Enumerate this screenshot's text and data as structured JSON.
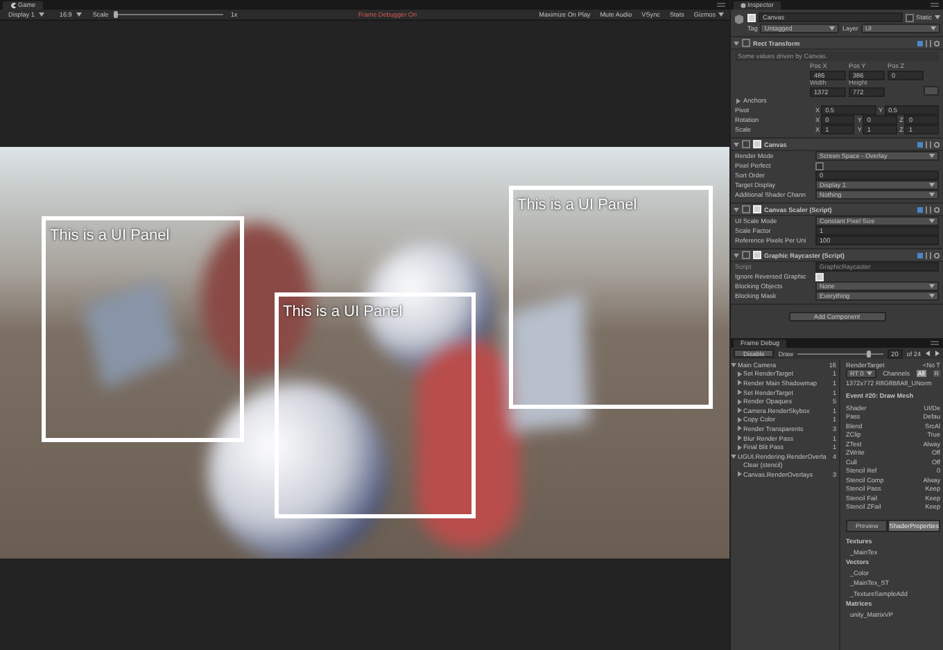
{
  "game": {
    "tab": "Game",
    "toolbar": {
      "display": "Display 1",
      "aspect": "16:9",
      "scale_label": "Scale",
      "scale_slider": {
        "level": 0
      },
      "scale_value": "1x",
      "frame_debugger": "Frame Debugger On",
      "toggles": [
        "Maximize On Play",
        "Mute Audio",
        "VSync",
        "Stats",
        "Gizmos"
      ]
    },
    "panels": [
      {
        "label": "This is a UI Panel"
      },
      {
        "label": "This is a UI Panel"
      },
      {
        "label": "This is a UI Panel"
      }
    ]
  },
  "inspector": {
    "tab": "Inspector",
    "object": {
      "name": "Canvas",
      "active": true,
      "static": "Static",
      "static_checked": false,
      "tag_label": "Tag",
      "tag": "Untagged",
      "layer_label": "Layer",
      "layer": "UI"
    },
    "components": [
      {
        "title": "Rect Transform",
        "note": "Some values driven by Canvas.",
        "rows": [
          {
            "kind": "stack",
            "cells": [
              {
                "label": "Pos X",
                "value": "486"
              },
              {
                "label": "Pos Y",
                "value": "386"
              },
              {
                "label": "Pos Z",
                "value": "0"
              }
            ]
          },
          {
            "kind": "stack",
            "cells": [
              {
                "label": "Width",
                "value": "1372"
              },
              {
                "label": "Height",
                "value": "772"
              }
            ]
          },
          {
            "kind": "heading",
            "label": "Anchors",
            "expanded": false
          },
          {
            "kind": "vec",
            "label": "Pivot",
            "cells": [
              {
                "axis": "X",
                "value": "0.5"
              },
              {
                "axis": "Y",
                "value": "0.5"
              }
            ]
          },
          {
            "kind": "vec",
            "label": "Rotation",
            "cells": [
              {
                "axis": "X",
                "value": "0"
              },
              {
                "axis": "Y",
                "value": "0"
              },
              {
                "axis": "Z",
                "value": "0"
              }
            ]
          },
          {
            "kind": "vec",
            "label": "Scale",
            "cells": [
              {
                "axis": "X",
                "value": "1"
              },
              {
                "axis": "Y",
                "value": "1"
              },
              {
                "axis": "Z",
                "value": "1"
              }
            ]
          }
        ]
      },
      {
        "title": "Canvas",
        "enabled": true,
        "rows": [
          {
            "kind": "dropdown",
            "label": "Render Mode",
            "value": "Screen Space - Overlay"
          },
          {
            "kind": "check",
            "label": "Pixel Perfect",
            "checked": false
          },
          {
            "kind": "field",
            "label": "Sort Order",
            "value": "0"
          },
          {
            "kind": "dropdown",
            "label": "Target Display",
            "value": "Display 1"
          },
          {
            "kind": "dropdown",
            "label": "Additional Shader Chann",
            "value": "Nothing"
          }
        ]
      },
      {
        "title": "Canvas Scaler (Script)",
        "enabled": true,
        "rows": [
          {
            "kind": "dropdown",
            "label": "UI Scale Mode",
            "value": "Constant Pixel Size"
          },
          {
            "kind": "field",
            "label": "Scale Factor",
            "value": "1"
          },
          {
            "kind": "field",
            "label": "Reference Pixels Per Uni",
            "value": "100"
          }
        ]
      },
      {
        "title": "Graphic Raycaster (Script)",
        "enabled": true,
        "rows": [
          {
            "kind": "script",
            "label": "Script",
            "value": "GraphicRaycaster"
          },
          {
            "kind": "check",
            "label": "Ignore Reversed Graphic",
            "checked": true
          },
          {
            "kind": "dropdown",
            "label": "Blocking Objects",
            "value": "None"
          },
          {
            "kind": "dropdown",
            "label": "Blocking Mask",
            "value": "Everything"
          }
        ]
      }
    ],
    "add_button": "Add Component"
  },
  "frame_debug": {
    "tab": "Frame Debug",
    "disable_button": "Disable",
    "slider_label": "Draw",
    "slider": {
      "level": 0.83
    },
    "event_value": "20",
    "event_total": "of 24",
    "tree": [
      {
        "label": "Main Camera",
        "count": "16",
        "expanded": true,
        "children": [
          {
            "label": "Set RenderTarget",
            "count": "1",
            "expanded": false
          },
          {
            "label": "Render Main Shadowmap",
            "count": "1",
            "expanded": false
          },
          {
            "label": "Set RenderTarget",
            "count": "1",
            "expanded": false
          },
          {
            "label": "Render Opaques",
            "count": "5",
            "expanded": false
          },
          {
            "label": "Camera.RenderSkybox",
            "count": "1",
            "expanded": false
          },
          {
            "label": "Copy Color",
            "count": "1",
            "expanded": false
          },
          {
            "label": "Render Transparents",
            "count": "3",
            "expanded": false
          },
          {
            "label": "Blur Render Pass",
            "count": "1",
            "expanded": false
          },
          {
            "label": "Final Blit Pass",
            "count": "1",
            "expanded": false
          }
        ]
      },
      {
        "label": "UGUI.Rendering.RenderOverla",
        "count": "4",
        "expanded": true,
        "children": [
          {
            "label": "Clear (stencil)"
          },
          {
            "label": "Canvas.RenderOverlays",
            "count": "3",
            "expanded": false
          }
        ]
      }
    ],
    "detail": {
      "target_label": "RenderTarget",
      "target_value": "<No T",
      "rt": "RT 0",
      "channels_label": "Channels",
      "channels": [
        {
          "label": "All",
          "selected": true
        },
        {
          "label": "R",
          "selected": false
        }
      ],
      "format": "1372x772 R8G8B8A8_UNorm",
      "event": "Event #20: Draw Mesh",
      "props": [
        {
          "name": "Shader",
          "value": "UI/De"
        },
        {
          "name": "Pass",
          "value": "Defau"
        },
        {
          "name": "Blend",
          "value": "SrcAl"
        },
        {
          "name": "ZClip",
          "value": "True"
        },
        {
          "name": "ZTest",
          "value": "Alway"
        },
        {
          "name": "ZWrite",
          "value": "Off"
        },
        {
          "name": "Cull",
          "value": "Off"
        },
        {
          "name": "Stencil Ref",
          "value": "0"
        },
        {
          "name": "Stencil Comp",
          "value": "Alway"
        },
        {
          "name": "Stencil Pass",
          "value": "Keep"
        },
        {
          "name": "Stencil Fail",
          "value": "Keep"
        },
        {
          "name": "Stencil ZFail",
          "value": "Keep"
        }
      ],
      "tabs": [
        {
          "label": "Preview",
          "selected": false
        },
        {
          "label": "ShaderProperties",
          "selected": true
        }
      ],
      "sections": [
        {
          "title": "Textures",
          "items": [
            "_MainTex"
          ]
        },
        {
          "title": "Vectors",
          "items": [
            "_Color",
            "_MainTex_ST",
            "_TextureSampleAdd"
          ]
        },
        {
          "title": "Matrices",
          "items": [
            "unity_MatrixVP"
          ]
        }
      ]
    }
  }
}
